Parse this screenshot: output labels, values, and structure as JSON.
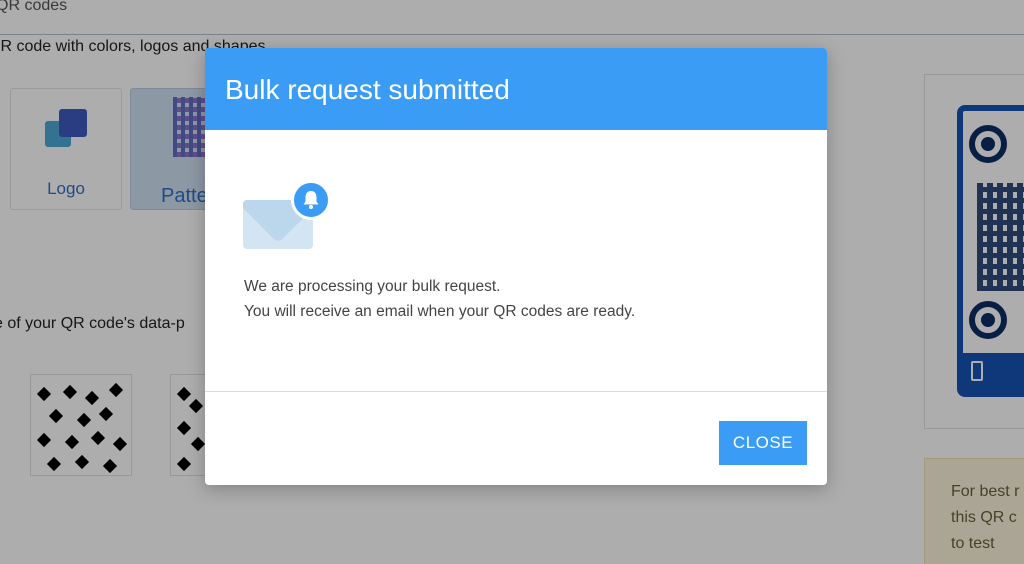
{
  "background": {
    "breadcrumb": "QR codes",
    "subtitle": "QR code with colors, logos and shapes",
    "tabs": [
      {
        "label": "Logo"
      },
      {
        "label": "Patte"
      }
    ],
    "pattern_hint": "e of your QR code's data-p",
    "preview_tip": [
      "For best r",
      "this QR c",
      "to test"
    ]
  },
  "modal": {
    "title": "Bulk request submitted",
    "icons": [
      "envelope-icon",
      "bell-icon"
    ],
    "message_line1": "We are processing your bulk request.",
    "message_line2": "You will receive an email when your QR codes are ready.",
    "close_label": "CLOSE"
  },
  "colors": {
    "accent": "#3a9cf5",
    "overlay": "rgba(0,0,0,0.32)",
    "link": "#2d71c9"
  }
}
